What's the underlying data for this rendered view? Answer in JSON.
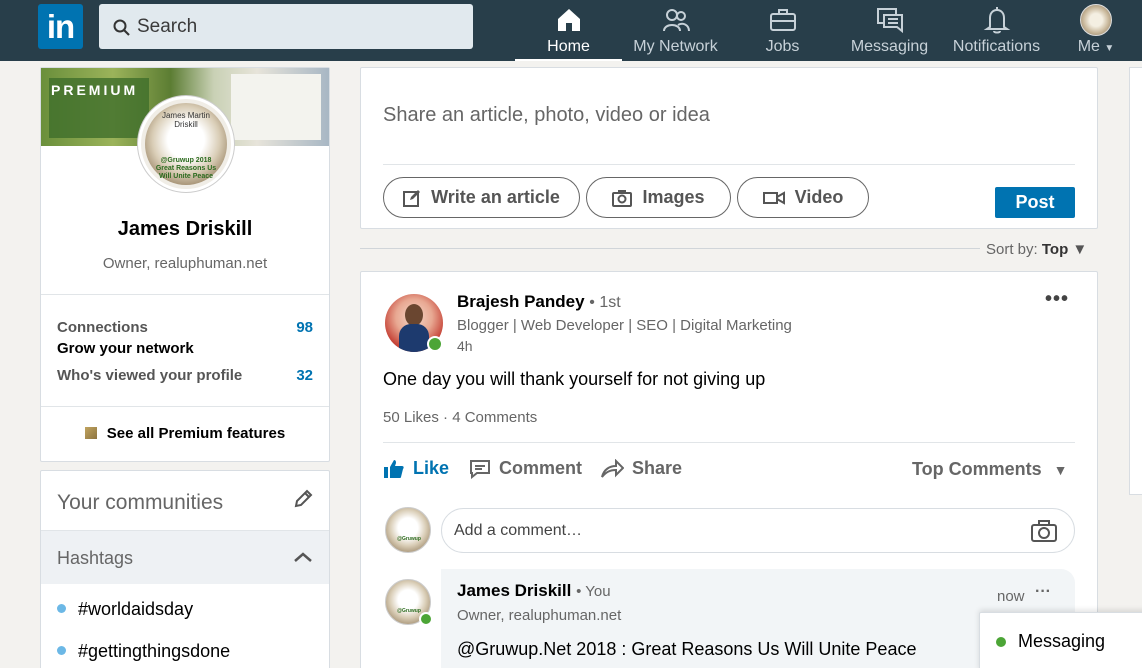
{
  "nav": {
    "logo": "in",
    "search_placeholder": "Search",
    "items": [
      {
        "label": "Home",
        "icon": "home-icon"
      },
      {
        "label": "My Network",
        "icon": "network-icon"
      },
      {
        "label": "Jobs",
        "icon": "briefcase-icon"
      },
      {
        "label": "Messaging",
        "icon": "messaging-icon"
      },
      {
        "label": "Notifications",
        "icon": "bell-icon"
      },
      {
        "label": "Me",
        "icon": "chevron-down-icon"
      }
    ]
  },
  "profile": {
    "badge": "PREMIUM",
    "name": "James Driskill",
    "headline": "Owner, realuphuman.net",
    "pic_text_top": "James Martin Driskill",
    "pic_text_bottom": "@Gruwup 2018 Great Reasons Us Will Unite Peace",
    "connections_label": "Connections",
    "connections_value": "98",
    "grow_label": "Grow your network",
    "viewed_label": "Who's viewed your profile",
    "viewed_value": "32",
    "premium_features": "See all Premium features"
  },
  "communities": {
    "title": "Your communities",
    "hashtags_label": "Hashtags",
    "tags": [
      "#worldaidsday",
      "#gettingthingsdone"
    ]
  },
  "share": {
    "placeholder": "Share an article, photo, video or idea",
    "write_article": "Write an article",
    "images": "Images",
    "video": "Video",
    "post": "Post"
  },
  "sort": {
    "label": "Sort by:",
    "value": "Top"
  },
  "post": {
    "author": "Brajesh Pandey",
    "degree": "• 1st",
    "headline": "Blogger | Web Developer | SEO | Digital Marketing",
    "time": "4h",
    "text": "One day you will thank yourself for not giving up",
    "likes": "50 Likes",
    "comments": "4 Comments",
    "like_label": "Like",
    "comment_label": "Comment",
    "share_label": "Share",
    "top_comments": "Top Comments",
    "comment_placeholder": "Add a comment…"
  },
  "reply": {
    "name": "James Driskill",
    "you": "• You",
    "headline": "Owner, realuphuman.net",
    "time": "now",
    "text": "@Gruwup.Net 2018 : Great Reasons Us Will Unite Peace"
  },
  "messaging": {
    "label": "Messaging"
  },
  "colors": {
    "brand": "#0073b1",
    "nav_bg": "#283e4a",
    "online": "#4ca536"
  }
}
